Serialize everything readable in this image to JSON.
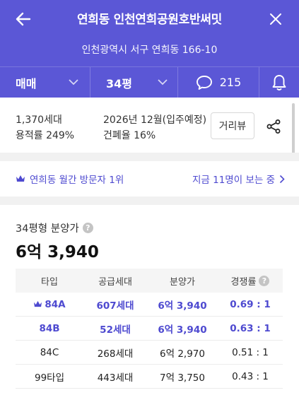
{
  "header": {
    "title": "연희동 인천연희공원호반써밋",
    "address": "인천광역시 서구 연희동 166-10"
  },
  "filters": {
    "deal_type": "매매",
    "area": "34평",
    "comment_count": "215"
  },
  "info": {
    "households": "1,370세대",
    "floor_area_ratio": "용적률 249%",
    "move_in": "2026년 12월(입주예정)",
    "building_coverage": "건폐율 16%",
    "distance_button": "거리뷰"
  },
  "visit": {
    "rank_text": "연희동 월간 방문자 1위",
    "viewers_text": "지금 11명이 보는 중"
  },
  "price": {
    "label": "34평형 분양가",
    "value": "6억 3,940"
  },
  "table": {
    "headers": [
      "타입",
      "공급세대",
      "분양가",
      "경쟁률"
    ],
    "rows": [
      {
        "type": "84A",
        "units": "607세대",
        "price": "6억 3,940",
        "ratio": "0.69 : 1"
      },
      {
        "type": "84B",
        "units": "52세대",
        "price": "6억 3,940",
        "ratio": "0.63 : 1"
      },
      {
        "type": "84C",
        "units": "268세대",
        "price": "6억 2,970",
        "ratio": "0.51 : 1"
      },
      {
        "type": "99타입",
        "units": "443세대",
        "price": "7억 3,750",
        "ratio": "0.43 : 1"
      }
    ]
  },
  "colors": {
    "brand": "#5b57d6",
    "accent_text": "#4e4ad0"
  }
}
